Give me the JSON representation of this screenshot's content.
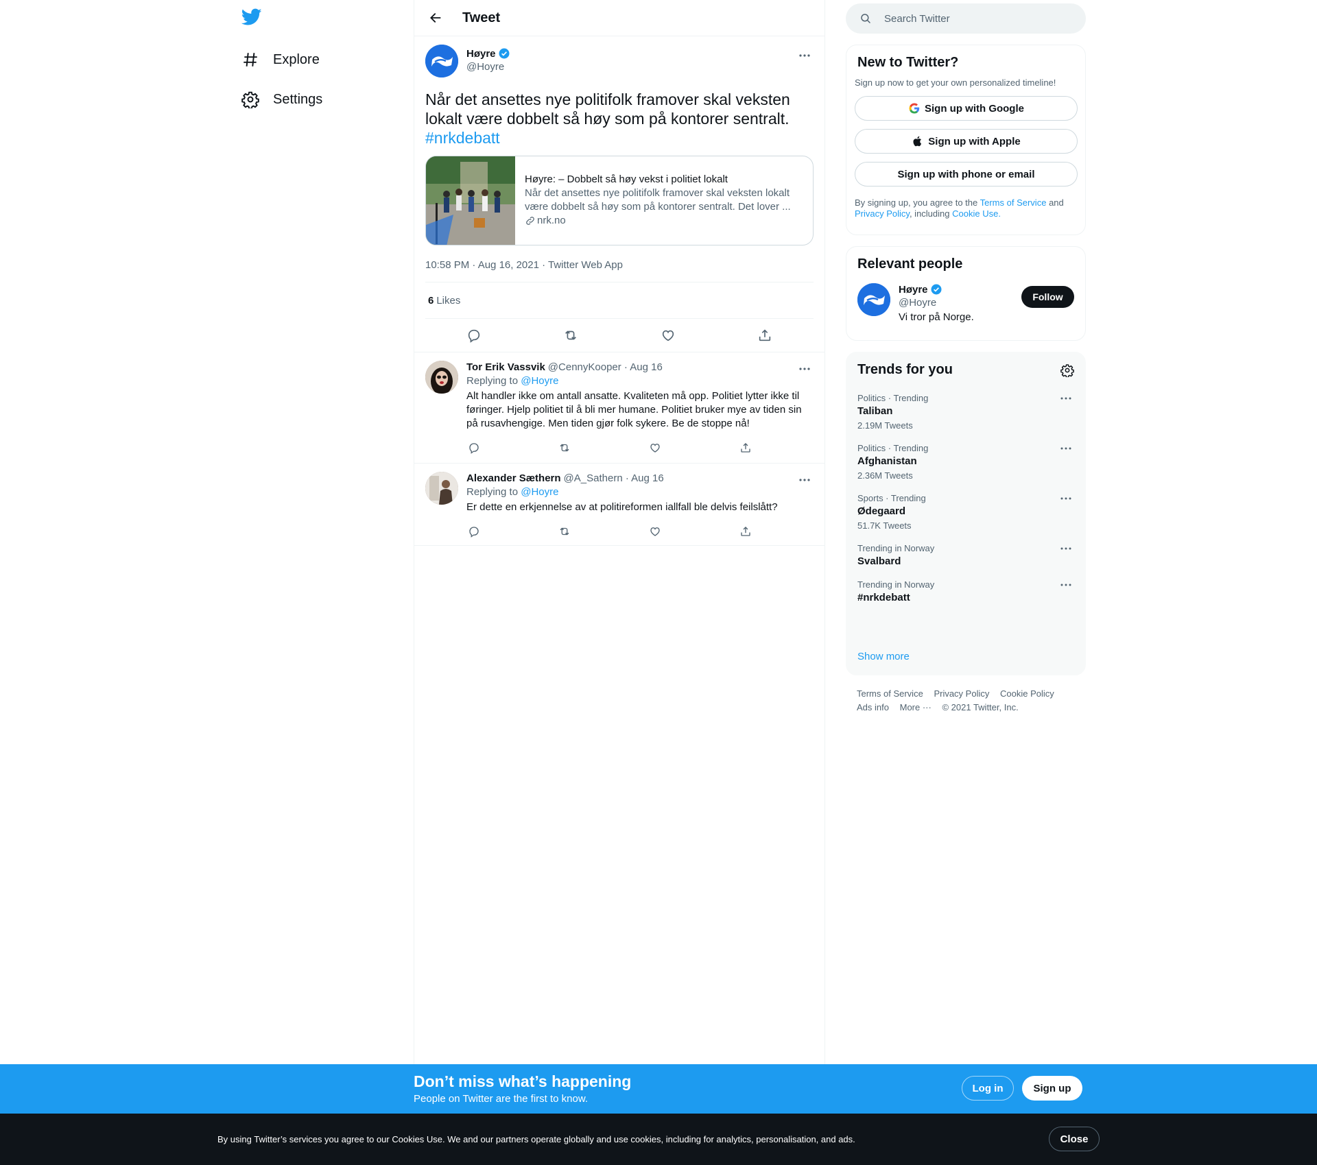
{
  "nav": {
    "items": [
      {
        "label": "Explore",
        "icon": "hashtag-icon"
      },
      {
        "label": "Settings",
        "icon": "gear-icon"
      }
    ]
  },
  "header": {
    "title": "Tweet"
  },
  "tweet": {
    "display_name": "Høyre",
    "handle": "@Hoyre",
    "text": "Når det ansettes nye politifolk framover skal veksten lokalt være dobbelt så høy som på kontorer sentralt.",
    "hashtag": "#nrkdebatt",
    "card": {
      "title": "Høyre: – Dobbelt så høy vekst i politiet lokalt",
      "description": "Når det ansettes nye politifolk framover skal veksten lokalt være dobbelt så høy som på kontorer sentralt. Det lover ...",
      "domain": "nrk.no"
    },
    "timestamp": "10:58 PM · Aug 16, 2021 · Twitter Web App",
    "likes_count": "6",
    "likes_label": "Likes"
  },
  "replies": [
    {
      "display_name": "Tor Erik Vassvik",
      "handle_date": "@CennyKooper · Aug 16",
      "replying_prefix": "Replying to",
      "replying_to": "@Hoyre",
      "text": "Alt handler ikke om antall ansatte. Kvaliteten må opp. Politiet lytter ikke til føringer. Hjelp politiet til å bli mer humane. Politiet bruker mye av tiden sin på rusavhengige. Men tiden gjør folk sykere. Be de stoppe nå!"
    },
    {
      "display_name": "Alexander Sæthern",
      "handle_date": "@A_Sathern · Aug 16",
      "replying_prefix": "Replying to",
      "replying_to": "@Hoyre",
      "text": "Er dette en erkjennelse av at politireformen iallfall ble delvis feilslått?"
    }
  ],
  "search": {
    "placeholder": "Search Twitter"
  },
  "new_to_twitter": {
    "title": "New to Twitter?",
    "subtitle": "Sign up now to get your own personalized timeline!",
    "google": "Sign up with Google",
    "apple": "Sign up with Apple",
    "phone": "Sign up with phone or email",
    "terms_prefix": "By signing up, you agree to the",
    "terms_link": "Terms of Service",
    "and": "and",
    "privacy_link": "Privacy Policy",
    "including": ", including",
    "cookie_link": "Cookie Use."
  },
  "relevant_people": {
    "title": "Relevant people",
    "display_name": "Høyre",
    "handle": "@Hoyre",
    "bio": "Vi tror på Norge.",
    "follow": "Follow"
  },
  "trends": {
    "title": "Trends for you",
    "items": [
      {
        "context": "Politics · Trending",
        "name": "Taliban",
        "count": "2.19M Tweets"
      },
      {
        "context": "Politics · Trending",
        "name": "Afghanistan",
        "count": "2.36M Tweets"
      },
      {
        "context": "Sports · Trending",
        "name": "Ødegaard",
        "count": "51.7K Tweets"
      },
      {
        "context": "Trending in Norway",
        "name": "Svalbard",
        "count": ""
      },
      {
        "context": "Trending in Norway",
        "name": "#nrkdebatt",
        "count": ""
      }
    ],
    "show_more": "Show more"
  },
  "footer": {
    "terms": "Terms of Service",
    "privacy": "Privacy Policy",
    "cookie": "Cookie Policy",
    "ads": "Ads info",
    "more": "More ···",
    "copyright": "© 2021 Twitter, Inc."
  },
  "bottom_bar": {
    "title": "Don’t miss what’s happening",
    "subtitle": "People on Twitter are the first to know.",
    "login": "Log in",
    "signup": "Sign up"
  },
  "cookie_bar": {
    "text": "By using Twitter’s services you agree to our Cookies Use. We and our partners operate globally and use cookies, including for analytics, personalisation, and ads.",
    "close": "Close"
  },
  "colors": {
    "accent": "#1d9bf0",
    "text": "#0f1419",
    "muted": "#536471",
    "cookie_bg": "#0f1419"
  }
}
